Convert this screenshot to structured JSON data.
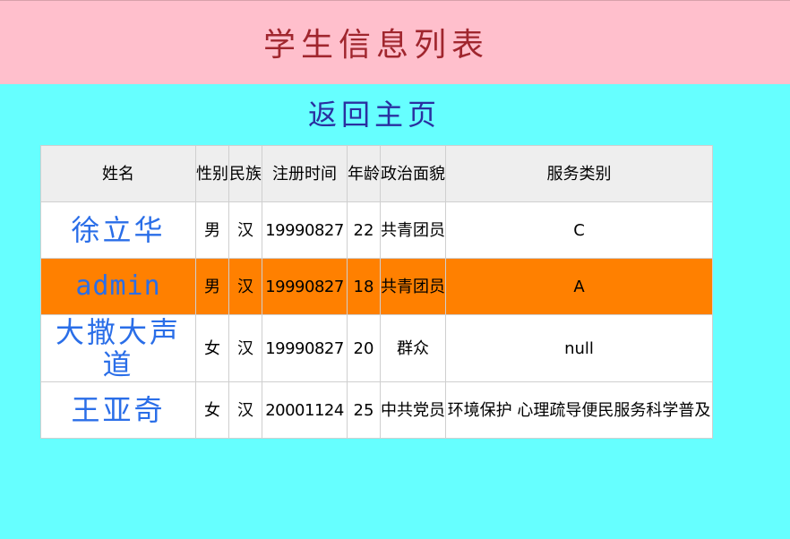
{
  "header": {
    "title": "学生信息列表",
    "background": "#ffbfcc",
    "title_color": "#a0262e"
  },
  "nav": {
    "home_link": "返回主页",
    "link_color": "#2a2fa0"
  },
  "page_background": "#66ffff",
  "table": {
    "columns": [
      "姓名",
      "性别",
      "民族",
      "注册时间",
      "年龄",
      "政治面貌",
      "服务类别"
    ],
    "rows": [
      {
        "name": "徐立华",
        "gender": "男",
        "ethnicity": "汉",
        "registered": "19990827",
        "age": "22",
        "political": "共青团员",
        "service": "C",
        "highlighted": false
      },
      {
        "name": "admin",
        "gender": "男",
        "ethnicity": "汉",
        "registered": "19990827",
        "age": "18",
        "political": "共青团员",
        "service": "A",
        "highlighted": true
      },
      {
        "name": "大撒大声道",
        "gender": "女",
        "ethnicity": "汉",
        "registered": "19990827",
        "age": "20",
        "political": "群众",
        "service": "null",
        "highlighted": false
      },
      {
        "name": "王亚奇",
        "gender": "女",
        "ethnicity": "汉",
        "registered": "20001124",
        "age": "25",
        "political": "中共党员",
        "service": "环境保护 心理疏导便民服务科学普及",
        "highlighted": false
      }
    ],
    "highlight_color": "#ff8000",
    "name_color": "#2a6ee8"
  }
}
